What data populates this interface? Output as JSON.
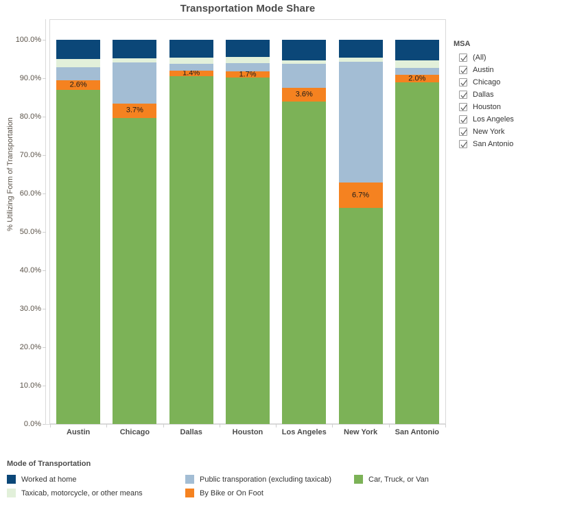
{
  "title": "Transportation Mode Share",
  "axes": {
    "y_label": "% Utilizing Form of Transportation",
    "y_ticks": [
      "100.0%",
      "90.0%",
      "80.0%",
      "70.0%",
      "60.0%",
      "50.0%",
      "40.0%",
      "30.0%",
      "20.0%",
      "10.0%",
      "0.0%"
    ]
  },
  "filter": {
    "title": "MSA",
    "items": [
      {
        "label": "(All)",
        "checked": true
      },
      {
        "label": "Austin",
        "checked": true
      },
      {
        "label": "Chicago",
        "checked": true
      },
      {
        "label": "Dallas",
        "checked": true
      },
      {
        "label": "Houston",
        "checked": true
      },
      {
        "label": "Los Angeles",
        "checked": true
      },
      {
        "label": "New York",
        "checked": true
      },
      {
        "label": "San Antonio",
        "checked": true
      }
    ]
  },
  "legend": {
    "title": "Mode of Transportation",
    "items": [
      {
        "label": "Worked at home",
        "color": "#0b4778",
        "col": 0,
        "row": 0
      },
      {
        "label": "Public transporation (excluding taxicab)",
        "color": "#a3bdd4",
        "col": 1,
        "row": 0
      },
      {
        "label": "Car, Truck, or Van",
        "color": "#7cb257",
        "col": 2,
        "row": 0
      },
      {
        "label": "Taxicab, motorcycle, or other means",
        "color": "#e2f0da",
        "col": 0,
        "row": 1
      },
      {
        "label": "By Bike or On Foot",
        "color": "#f58220",
        "col": 1,
        "row": 1
      }
    ]
  },
  "chart_data": {
    "type": "bar",
    "subtype": "stacked-100",
    "title": "Transportation Mode Share",
    "xlabel": "",
    "ylabel": "% Utilizing Form of Transportation",
    "ylim": [
      0,
      100
    ],
    "ytick_step": 10,
    "grid": false,
    "legend_position": "bottom",
    "categories": [
      "Austin",
      "Chicago",
      "Dallas",
      "Houston",
      "Los Angeles",
      "New York",
      "San Antonio"
    ],
    "stack_order_bottom_to_top": [
      "Car, Truck, or Van",
      "By Bike or On Foot",
      "Public transporation (excluding taxicab)",
      "Taxicab, motorcycle, or other means",
      "Worked at home"
    ],
    "series": [
      {
        "name": "Car, Truck, or Van",
        "color": "#7cb257",
        "values": [
          86.9,
          79.7,
          90.6,
          90.1,
          83.9,
          56.2,
          88.9
        ],
        "labels": [
          "",
          "",
          "",
          "",
          "",
          "",
          ""
        ]
      },
      {
        "name": "By Bike or On Foot",
        "color": "#f58220",
        "values": [
          2.6,
          3.7,
          1.4,
          1.7,
          3.6,
          6.7,
          2.0
        ],
        "labels": [
          "2.6%",
          "3.7%",
          "1.4%",
          "1.7%",
          "3.6%",
          "6.7%",
          "2.0%"
        ]
      },
      {
        "name": "Public transporation (excluding taxicab)",
        "color": "#a3bdd4",
        "values": [
          3.4,
          10.7,
          1.8,
          2.1,
          6.2,
          31.3,
          1.8
        ],
        "labels": [
          "",
          "",
          "",
          "",
          "",
          "",
          ""
        ]
      },
      {
        "name": "Taxicab, motorcycle, or other means",
        "color": "#e2f0da",
        "values": [
          2.1,
          1.1,
          1.6,
          1.6,
          0.9,
          1.2,
          2.0
        ],
        "labels": [
          "",
          "",
          "",
          "",
          "",
          "",
          ""
        ]
      },
      {
        "name": "Worked at home",
        "color": "#0b4778",
        "values": [
          5.0,
          4.8,
          4.6,
          4.5,
          5.4,
          4.6,
          5.3
        ],
        "labels": [
          "",
          "",
          "",
          "",
          "",
          "",
          ""
        ]
      }
    ]
  }
}
